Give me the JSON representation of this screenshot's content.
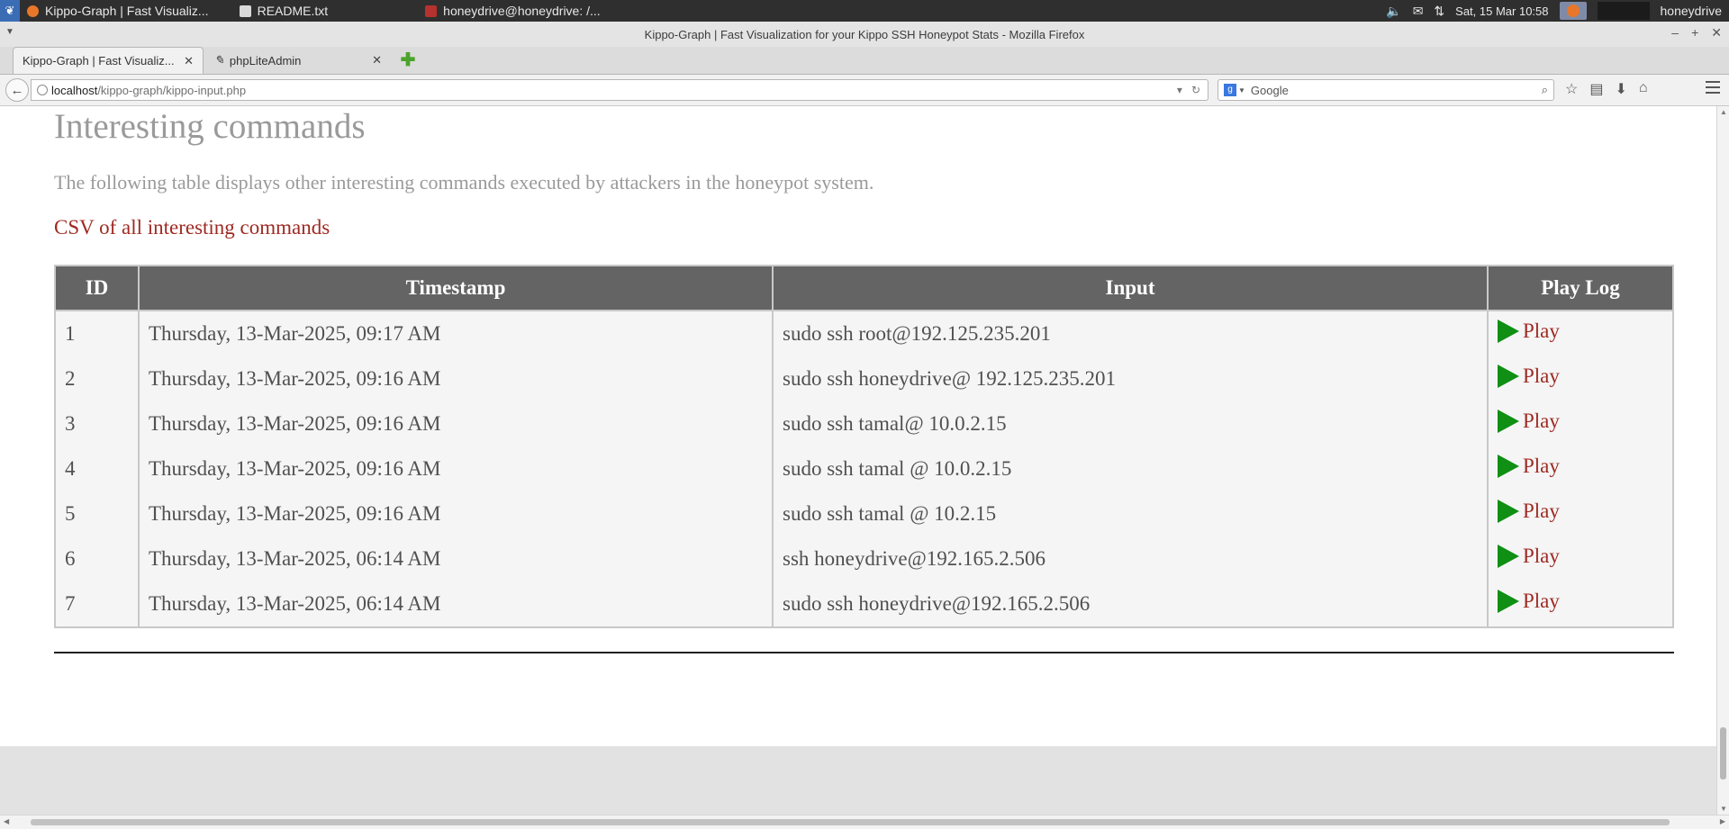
{
  "taskbar": {
    "tasks": [
      {
        "label": "Kippo-Graph | Fast Visualiz...",
        "icon": "firefox-icon"
      },
      {
        "label": "README.txt",
        "icon": "text-editor-icon"
      },
      {
        "label": "honeydrive@honeydrive: /...",
        "icon": "terminal-icon"
      }
    ],
    "clock": "Sat, 15 Mar  10:58",
    "user": "honeydrive"
  },
  "window": {
    "title": "Kippo-Graph | Fast Visualization for your Kippo SSH Honeypot Stats - Mozilla Firefox"
  },
  "tabs": [
    {
      "label": "Kippo-Graph | Fast Visualiz...",
      "active": true
    },
    {
      "label": "phpLiteAdmin",
      "active": false
    }
  ],
  "nav": {
    "url_host": "localhost",
    "url_path": "/kippo-graph/kippo-input.php",
    "search_placeholder": "Google"
  },
  "page": {
    "heading": "Interesting commands",
    "description": "The following table displays other interesting commands executed by attackers in the honeypot system.",
    "csv_link": "CSV of all interesting commands",
    "table": {
      "headers": [
        "ID",
        "Timestamp",
        "Input",
        "Play Log"
      ],
      "play_label": "Play",
      "rows": [
        {
          "id": "1",
          "timestamp": "Thursday, 13-Mar-2025, 09:17 AM",
          "input": "sudo ssh root@192.125.235.201"
        },
        {
          "id": "2",
          "timestamp": "Thursday, 13-Mar-2025, 09:16 AM",
          "input": "sudo ssh honeydrive@ 192.125.235.201"
        },
        {
          "id": "3",
          "timestamp": "Thursday, 13-Mar-2025, 09:16 AM",
          "input": "sudo ssh tamal@ 10.0.2.15"
        },
        {
          "id": "4",
          "timestamp": "Thursday, 13-Mar-2025, 09:16 AM",
          "input": "sudo ssh tamal @ 10.0.2.15"
        },
        {
          "id": "5",
          "timestamp": "Thursday, 13-Mar-2025, 09:16 AM",
          "input": "sudo ssh tamal @ 10.2.15"
        },
        {
          "id": "6",
          "timestamp": "Thursday, 13-Mar-2025, 06:14 AM",
          "input": "ssh honeydrive@192.165.2.506"
        },
        {
          "id": "7",
          "timestamp": "Thursday, 13-Mar-2025, 06:14 AM",
          "input": "sudo ssh honeydrive@192.165.2.506"
        }
      ]
    }
  },
  "colors": {
    "link": "#9e2a22",
    "header_bg": "#646464",
    "play_icon": "#0f8f13",
    "muted_text": "#9a9a9a"
  }
}
